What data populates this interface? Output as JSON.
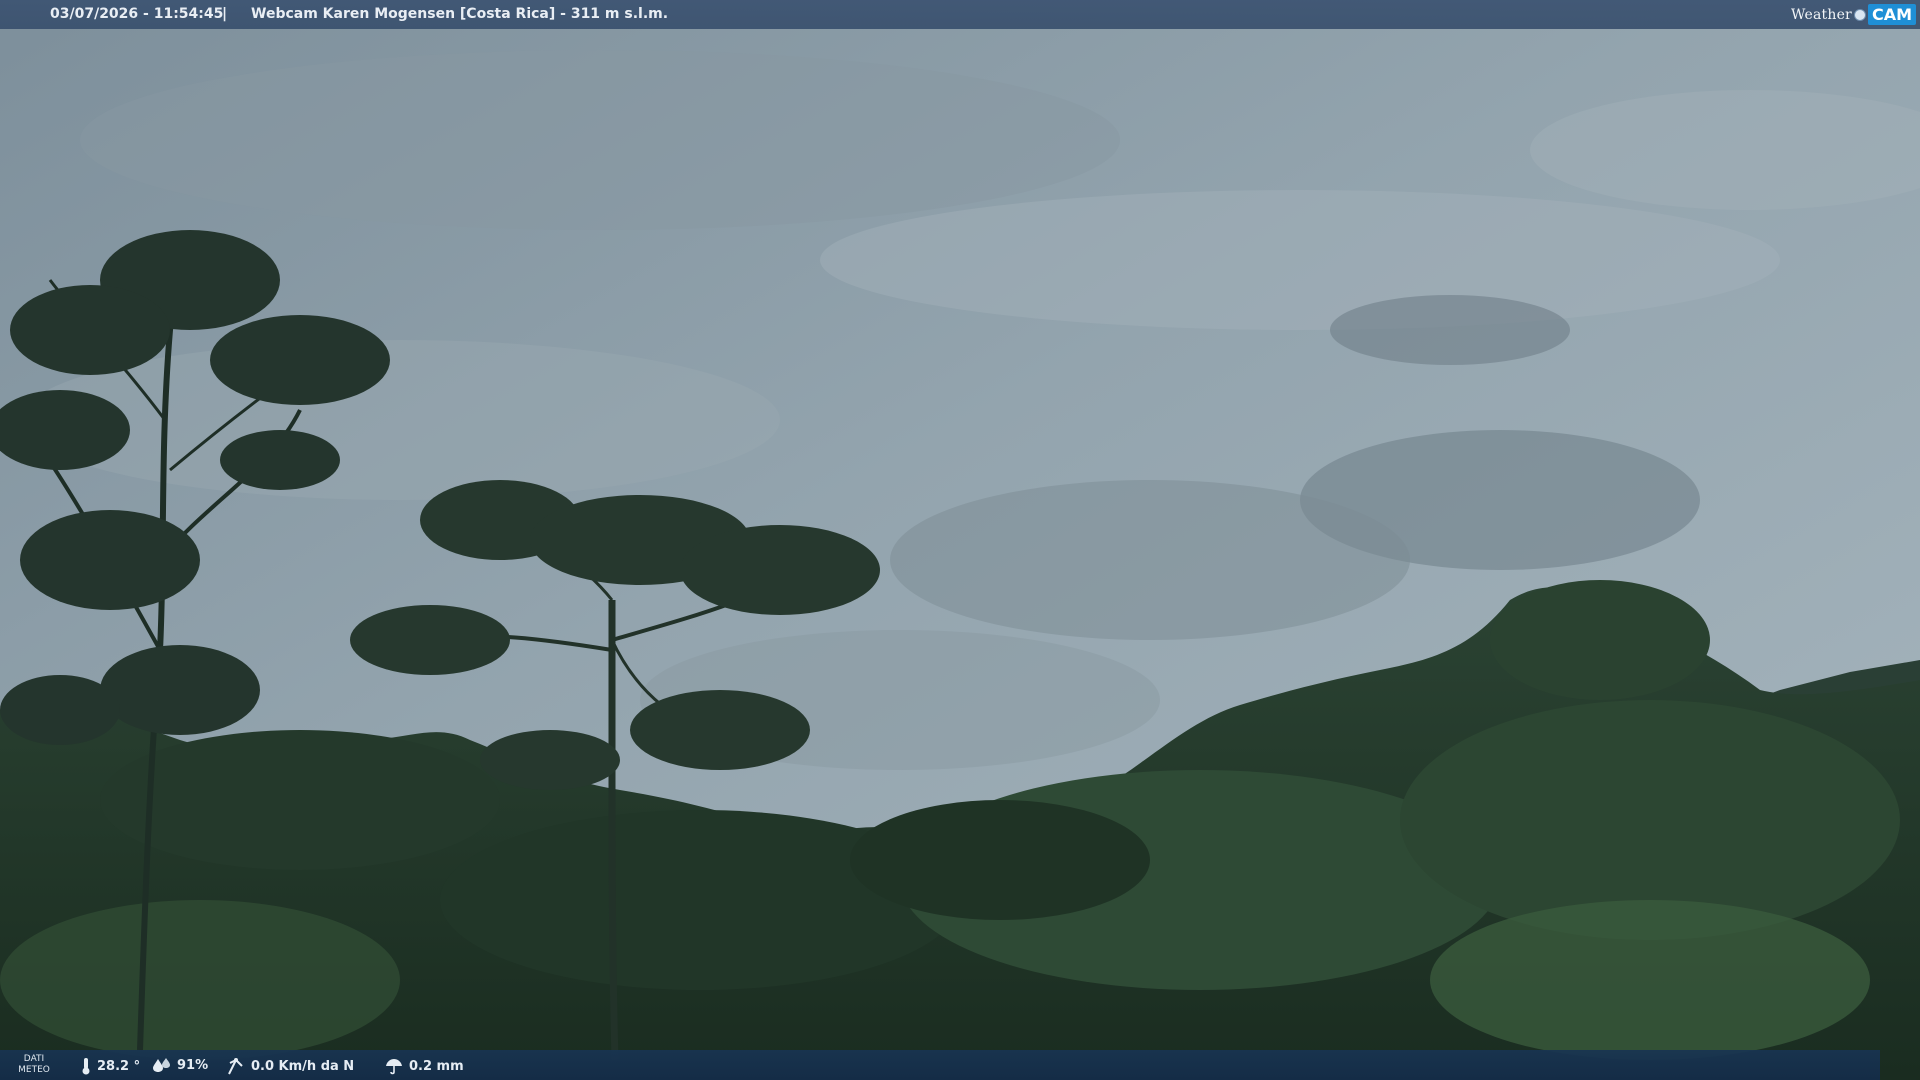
{
  "header": {
    "datetime": "03/07/2026 - 11:54:45",
    "separator": "|",
    "title": "Webcam Karen Mogensen [Costa Rica] - 311 m s.l.m.",
    "logo_word": "Weather",
    "logo_cam": "CAM"
  },
  "footer": {
    "meteo_label_line1": "DATI",
    "meteo_label_line2": "METEO",
    "temperature": "28.2 °",
    "humidity": "91%",
    "wind": "0.0 Km/h da N",
    "rain": "0.2 mm"
  },
  "icons": [
    "thermometer-icon",
    "humidity-drops-icon",
    "wind-icon",
    "rain-umbrella-icon"
  ],
  "colors": {
    "sky": "#8e9faa",
    "forest": "#1f3326",
    "header_bar": "#3e5573",
    "footer_bar": "#18344f",
    "logo_accent": "#1f8fd6"
  }
}
